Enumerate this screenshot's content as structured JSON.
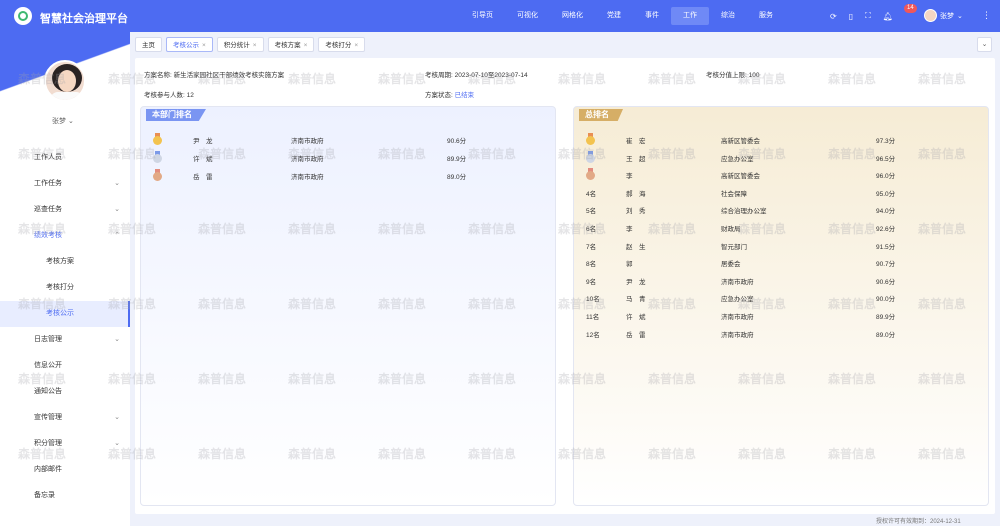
{
  "app": {
    "title": "智慧社会治理平台"
  },
  "nav": [
    "引导页",
    "可视化",
    "网格化",
    "党建",
    "事件",
    "工作",
    "综治",
    "服务"
  ],
  "nav_active": "工作",
  "header": {
    "badge": "14",
    "user": "张梦"
  },
  "sidebar": {
    "user": "张梦",
    "items": [
      {
        "label": "工作人员",
        "chev": ""
      },
      {
        "label": "工作任务",
        "chev": "⌄"
      },
      {
        "label": "巡查任务",
        "chev": "⌄"
      },
      {
        "label": "绩效考核",
        "chev": "⌃"
      },
      {
        "label": "考核方案",
        "chev": ""
      },
      {
        "label": "考核打分",
        "chev": ""
      },
      {
        "label": "考核公示",
        "chev": ""
      },
      {
        "label": "日志管理",
        "chev": "⌄"
      },
      {
        "label": "信息公开",
        "chev": ""
      },
      {
        "label": "通知公告",
        "chev": ""
      },
      {
        "label": "宣传管理",
        "chev": "⌄"
      },
      {
        "label": "积分管理",
        "chev": "⌄"
      },
      {
        "label": "内部邮件",
        "chev": ""
      },
      {
        "label": "备忘录",
        "chev": ""
      }
    ]
  },
  "tabs": [
    "主页",
    "考核公示",
    "积分统计",
    "考核方案",
    "考核打分"
  ],
  "more": "⌄",
  "info": {
    "plan_label": "方案名称:",
    "plan_value": "新生活家园社区干部绩效考核实施方案",
    "period_label": "考核周期:",
    "period_value": "2023-07-10至2023-07-14",
    "limit_label": "考核分值上限:",
    "limit_value": "100",
    "count_label": "考核参与人数:",
    "count_value": "12",
    "status_label": "方案状态:",
    "status_value": "已结束"
  },
  "dept_rank": {
    "title": "本部门排名",
    "rows": [
      {
        "rank": "",
        "name": "尹　龙",
        "org": "济南市政府",
        "score": "90.6分",
        "medal": "gold"
      },
      {
        "rank": "",
        "name": "许　斌",
        "org": "济南市政府",
        "score": "89.9分",
        "medal": "silver"
      },
      {
        "rank": "",
        "name": "岳　雷",
        "org": "济南市政府",
        "score": "89.0分",
        "medal": "bronze"
      }
    ]
  },
  "total_rank": {
    "title": "总排名",
    "rows": [
      {
        "rank": "",
        "name": "崔　宏",
        "org": "高新区管委会",
        "score": "97.3分",
        "medal": "gold"
      },
      {
        "rank": "",
        "name": "王　超",
        "org": "应急办公室",
        "score": "96.5分",
        "medal": "silver"
      },
      {
        "rank": "",
        "name": "李",
        "org": "高新区管委会",
        "score": "96.0分",
        "medal": "bronze"
      },
      {
        "rank": "4名",
        "name": "郝　海",
        "org": "社会保障",
        "score": "95.0分",
        "medal": ""
      },
      {
        "rank": "5名",
        "name": "刘　秀",
        "org": "综合治理办公室",
        "score": "94.0分",
        "medal": ""
      },
      {
        "rank": "6名",
        "name": "李",
        "org": "财政局",
        "score": "92.6分",
        "medal": ""
      },
      {
        "rank": "7名",
        "name": "赵　生",
        "org": "智元部门",
        "score": "91.5分",
        "medal": ""
      },
      {
        "rank": "8名",
        "name": "郭",
        "org": "居委会",
        "score": "90.7分",
        "medal": ""
      },
      {
        "rank": "9名",
        "name": "尹　龙",
        "org": "济南市政府",
        "score": "90.6分",
        "medal": ""
      },
      {
        "rank": "10名",
        "name": "马　青",
        "org": "应急办公室",
        "score": "90.0分",
        "medal": ""
      },
      {
        "rank": "11名",
        "name": "许　斌",
        "org": "济南市政府",
        "score": "89.9分",
        "medal": ""
      },
      {
        "rank": "12名",
        "name": "岳　雷",
        "org": "济南市政府",
        "score": "89.0分",
        "medal": ""
      }
    ]
  },
  "watermark": "森普信息",
  "footer": "授权许可有效期到：2024-12-31",
  "colors": {
    "primary": "#4d6bf2",
    "gold_panel": "#d6ae66",
    "blue_panel": "#7a95f2"
  }
}
